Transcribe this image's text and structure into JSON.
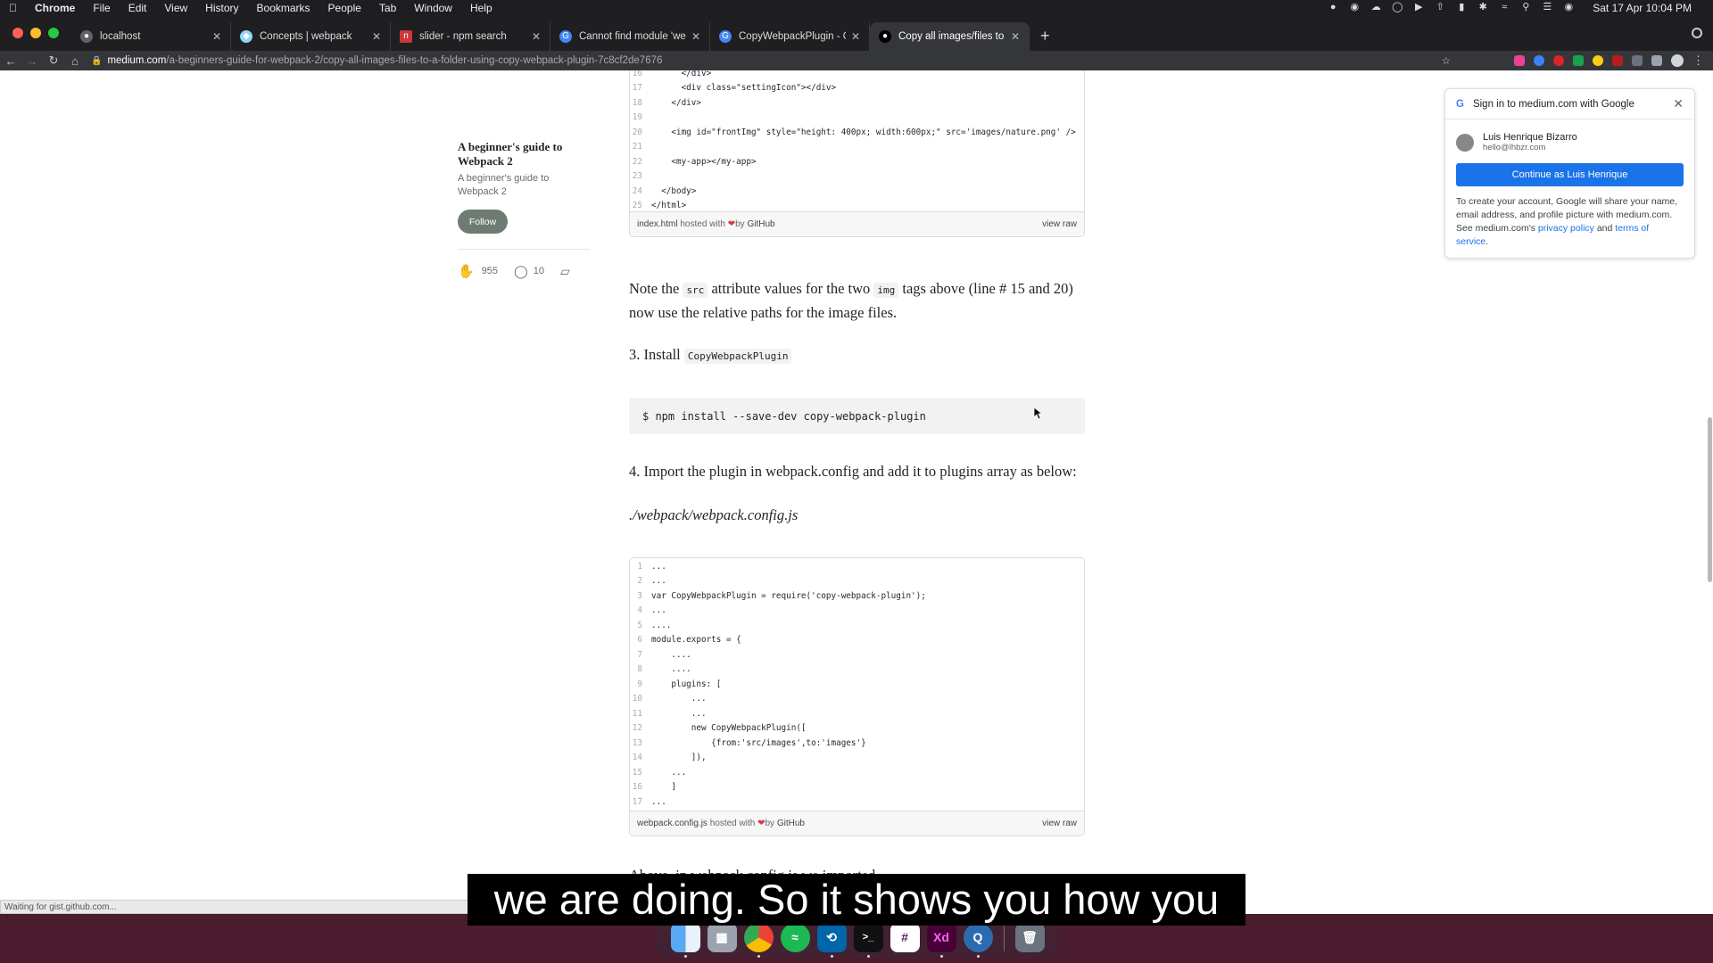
{
  "menubar": {
    "app": "Chrome",
    "items": [
      "File",
      "Edit",
      "View",
      "History",
      "Bookmarks",
      "People",
      "Tab",
      "Window",
      "Help"
    ],
    "clock": "Sat 17 Apr  10:04 PM"
  },
  "tabs": [
    {
      "title": "localhost",
      "favicon_color": "#5f6368",
      "active": false
    },
    {
      "title": "Concepts | webpack",
      "favicon_color": "#8ed6fb",
      "active": false
    },
    {
      "title": "slider - npm search",
      "favicon_color": "#cb3837",
      "active": false
    },
    {
      "title": "Cannot find module 'webpack'",
      "favicon_color": "#4285f4",
      "active": false
    },
    {
      "title": "CopyWebpackPlugin - Google",
      "favicon_color": "#4285f4",
      "active": false
    },
    {
      "title": "Copy all images/files to a folde",
      "favicon_color": "#000000",
      "active": true
    }
  ],
  "url": {
    "host": "medium.com",
    "path": "/a-beginners-guide-for-webpack-2/copy-all-images-files-to-a-folder-using-copy-webpack-plugin-7c8cf2de7676"
  },
  "sidebar": {
    "pub_title": "A beginner's guide to Webpack 2",
    "pub_subtitle": "A beginner's guide to Webpack 2",
    "follow_label": "Follow",
    "claps": "955",
    "comments": "10"
  },
  "gist1": {
    "lines": [
      {
        "n": "16",
        "text": "      </div>"
      },
      {
        "n": "17",
        "text": "      <div class=\"settingIcon\"></div>"
      },
      {
        "n": "18",
        "text": "    </div>"
      },
      {
        "n": "19",
        "text": ""
      },
      {
        "n": "20",
        "text": "    <img id=\"frontImg\" style=\"height: 400px; width:600px;\" src='images/nature.png' />"
      },
      {
        "n": "21",
        "text": ""
      },
      {
        "n": "22",
        "text": "    <my-app></my-app>"
      },
      {
        "n": "23",
        "text": ""
      },
      {
        "n": "24",
        "text": "  </body>"
      },
      {
        "n": "25",
        "text": "</html>"
      }
    ],
    "file": "index.html",
    "hosted": "hosted with",
    "by": "by",
    "github": "GitHub",
    "view_raw": "view raw"
  },
  "prose": {
    "p1_a": "Note the ",
    "p1_code1": "src",
    "p1_b": " attribute values for the two ",
    "p1_code2": "img",
    "p1_c": " tags above (line # 15 and 20) now use the relative paths for the image files.",
    "step3": "3. Install ",
    "step3_code": "CopyWebpackPlugin",
    "npm_cmd": "$ npm install --save-dev copy-webpack-plugin",
    "step4": "4. Import the plugin in webpack.config and add it to plugins array as below:",
    "config_path": "./webpack/webpack.config.js",
    "cut_line": "Above, in webpack.config.js we imported"
  },
  "gist2": {
    "lines": [
      {
        "n": "1",
        "text": "..."
      },
      {
        "n": "2",
        "text": "..."
      },
      {
        "n": "3",
        "text": "var CopyWebpackPlugin = require('copy-webpack-plugin');"
      },
      {
        "n": "4",
        "text": "..."
      },
      {
        "n": "5",
        "text": "...."
      },
      {
        "n": "6",
        "text": "module.exports = {"
      },
      {
        "n": "7",
        "text": "    ...."
      },
      {
        "n": "8",
        "text": "    ...."
      },
      {
        "n": "9",
        "text": "    plugins: ["
      },
      {
        "n": "10",
        "text": "        ..."
      },
      {
        "n": "11",
        "text": "        ..."
      },
      {
        "n": "12",
        "text": "        new CopyWebpackPlugin(["
      },
      {
        "n": "13",
        "text": "            {from:'src/images',to:'images'}"
      },
      {
        "n": "14",
        "text": "        ]),"
      },
      {
        "n": "15",
        "text": "    ..."
      },
      {
        "n": "16",
        "text": "    ]"
      },
      {
        "n": "17",
        "text": "..."
      }
    ],
    "file": "webpack.config.js",
    "hosted": "hosted with",
    "by": "by",
    "github": "GitHub",
    "view_raw": "view raw"
  },
  "google_signin": {
    "title": "Sign in to medium.com with Google",
    "name": "Luis Henrique Bizarro",
    "email": "hello@lhbzr.com",
    "continue_label": "Continue as Luis Henrique",
    "terms_a": "To create your account, Google will share your name, email address, and profile picture with medium.com. See medium.com's ",
    "privacy": "privacy policy",
    "and": " and ",
    "tos": "terms of service",
    "period": "."
  },
  "status_text": "Waiting for gist.github.com...",
  "caption": "we are doing. So it shows you how you",
  "dock": [
    "Finder",
    "Launchpad",
    "Chrome",
    "Spotify",
    "VS Code",
    "Terminal",
    "Slack",
    "Adobe XD",
    "QuickTime",
    "Trash"
  ],
  "colors": {
    "medium_follow": "#6e7b72",
    "google_blue": "#1a73e8",
    "desktop": "#4a1c2e"
  }
}
